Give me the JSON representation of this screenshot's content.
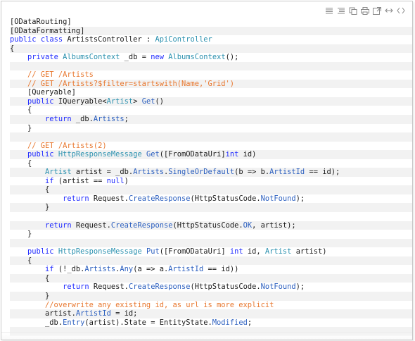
{
  "toolbar": {
    "icons": [
      "view-source-icon",
      "copy-icon",
      "copy-to-clipboard-icon",
      "print-icon",
      "popup-icon",
      "expand-icon",
      "code-icon"
    ]
  },
  "colors": {
    "keyword": "#1f2aff",
    "type": "#2b91af",
    "comment": "#e8772e",
    "string": "#d0462f",
    "method": "#2b5fbf",
    "plain": "#1a1a1a",
    "alt_row": "#f2f2f2"
  },
  "code_lines": [
    [
      [
        "plain",
        "[ODataRouting]"
      ]
    ],
    [
      [
        "plain",
        "[ODataFormatting]"
      ]
    ],
    [
      [
        "keyword",
        "public"
      ],
      [
        "plain",
        " "
      ],
      [
        "keyword",
        "class"
      ],
      [
        "plain",
        " ArtistsController : "
      ],
      [
        "type",
        "ApiController"
      ]
    ],
    [
      [
        "plain",
        "{"
      ]
    ],
    [
      [
        "plain",
        "    "
      ],
      [
        "keyword",
        "private"
      ],
      [
        "plain",
        " "
      ],
      [
        "type",
        "AlbumsContext"
      ],
      [
        "plain",
        " _db = "
      ],
      [
        "keyword",
        "new"
      ],
      [
        "plain",
        " "
      ],
      [
        "type",
        "AlbumsContext"
      ],
      [
        "plain",
        "();"
      ]
    ],
    [],
    [
      [
        "plain",
        "    "
      ],
      [
        "comment",
        "// GET /Artists"
      ]
    ],
    [
      [
        "plain",
        "    "
      ],
      [
        "comment",
        "// GET /Artists?$filter=startswith(Name,'Grid')"
      ]
    ],
    [
      [
        "plain",
        "    [Queryable]"
      ]
    ],
    [
      [
        "plain",
        "    "
      ],
      [
        "keyword",
        "public"
      ],
      [
        "plain",
        " IQueryable<"
      ],
      [
        "type",
        "Artist"
      ],
      [
        "plain",
        "> "
      ],
      [
        "method",
        "Get"
      ],
      [
        "plain",
        "()"
      ]
    ],
    [
      [
        "plain",
        "    {"
      ]
    ],
    [
      [
        "plain",
        "        "
      ],
      [
        "keyword",
        "return"
      ],
      [
        "plain",
        " _db."
      ],
      [
        "method",
        "Artists"
      ],
      [
        "plain",
        ";"
      ]
    ],
    [
      [
        "plain",
        "    }"
      ]
    ],
    [],
    [
      [
        "plain",
        "    "
      ],
      [
        "comment",
        "// GET /Artists(2)"
      ]
    ],
    [
      [
        "plain",
        "    "
      ],
      [
        "keyword",
        "public"
      ],
      [
        "plain",
        " "
      ],
      [
        "type",
        "HttpResponseMessage"
      ],
      [
        "plain",
        " "
      ],
      [
        "method",
        "Get"
      ],
      [
        "plain",
        "([FromODataUri]"
      ],
      [
        "keyword",
        "int"
      ],
      [
        "plain",
        " id)"
      ]
    ],
    [
      [
        "plain",
        "    {"
      ]
    ],
    [
      [
        "plain",
        "        "
      ],
      [
        "type",
        "Artist"
      ],
      [
        "plain",
        " artist = _db."
      ],
      [
        "method",
        "Artists"
      ],
      [
        "plain",
        "."
      ],
      [
        "method",
        "SingleOrDefault"
      ],
      [
        "plain",
        "(b => b."
      ],
      [
        "method",
        "ArtistId"
      ],
      [
        "plain",
        " == id);"
      ]
    ],
    [
      [
        "plain",
        "        "
      ],
      [
        "keyword",
        "if"
      ],
      [
        "plain",
        " (artist == "
      ],
      [
        "keyword",
        "null"
      ],
      [
        "plain",
        ")"
      ]
    ],
    [
      [
        "plain",
        "        {"
      ]
    ],
    [
      [
        "plain",
        "            "
      ],
      [
        "keyword",
        "return"
      ],
      [
        "plain",
        " Request."
      ],
      [
        "method",
        "CreateResponse"
      ],
      [
        "plain",
        "(HttpStatusCode."
      ],
      [
        "method",
        "NotFound"
      ],
      [
        "plain",
        ");"
      ]
    ],
    [
      [
        "plain",
        "        }"
      ]
    ],
    [],
    [
      [
        "plain",
        "        "
      ],
      [
        "keyword",
        "return"
      ],
      [
        "plain",
        " Request."
      ],
      [
        "method",
        "CreateResponse"
      ],
      [
        "plain",
        "(HttpStatusCode."
      ],
      [
        "method",
        "OK"
      ],
      [
        "plain",
        ", artist);"
      ]
    ],
    [
      [
        "plain",
        "    }"
      ]
    ],
    [],
    [
      [
        "plain",
        "    "
      ],
      [
        "keyword",
        "public"
      ],
      [
        "plain",
        " "
      ],
      [
        "type",
        "HttpResponseMessage"
      ],
      [
        "plain",
        " "
      ],
      [
        "method",
        "Put"
      ],
      [
        "plain",
        "([FromODataUri] "
      ],
      [
        "keyword",
        "int"
      ],
      [
        "plain",
        " id, "
      ],
      [
        "type",
        "Artist"
      ],
      [
        "plain",
        " artist)"
      ]
    ],
    [
      [
        "plain",
        "    {"
      ]
    ],
    [
      [
        "plain",
        "        "
      ],
      [
        "keyword",
        "if"
      ],
      [
        "plain",
        " (!_db."
      ],
      [
        "method",
        "Artists"
      ],
      [
        "plain",
        "."
      ],
      [
        "method",
        "Any"
      ],
      [
        "plain",
        "(a => a."
      ],
      [
        "method",
        "ArtistId"
      ],
      [
        "plain",
        " == id))"
      ]
    ],
    [
      [
        "plain",
        "        {"
      ]
    ],
    [
      [
        "plain",
        "            "
      ],
      [
        "keyword",
        "return"
      ],
      [
        "plain",
        " Request."
      ],
      [
        "method",
        "CreateResponse"
      ],
      [
        "plain",
        "(HttpStatusCode."
      ],
      [
        "method",
        "NotFound"
      ],
      [
        "plain",
        ");"
      ]
    ],
    [
      [
        "plain",
        "        }"
      ]
    ],
    [
      [
        "plain",
        "        "
      ],
      [
        "comment",
        "//overwrite any existing id, as url is more explicit"
      ]
    ],
    [
      [
        "plain",
        "        artist."
      ],
      [
        "method",
        "ArtistId"
      ],
      [
        "plain",
        " = id;"
      ]
    ],
    [
      [
        "plain",
        "        _db."
      ],
      [
        "method",
        "Entry"
      ],
      [
        "plain",
        "(artist).State = EntityState."
      ],
      [
        "method",
        "Modified"
      ],
      [
        "plain",
        ";"
      ]
    ],
    []
  ]
}
